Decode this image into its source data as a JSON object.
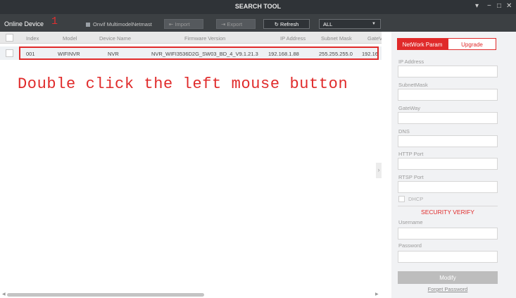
{
  "window": {
    "title": "SEARCH TOOL",
    "controls": [
      "▾",
      "−",
      "□",
      "✕"
    ]
  },
  "toolbar": {
    "online_label": "Online Device",
    "marker": "1",
    "onvif_label": "Onvif MultimodelNetmast",
    "import_label": "Import",
    "export_label": "Export",
    "refresh_label": "Refresh",
    "filter_value": "ALL"
  },
  "table": {
    "columns": [
      "Index",
      "Model",
      "Device Name",
      "Firmware Version",
      "IP Address",
      "Subnet Mask",
      "GateV"
    ],
    "rows": [
      {
        "index": "001",
        "model": "WIFINVR",
        "device_name": "NVR",
        "firmware": "NVR_WIFI3536D2G_SW03_BD_4_V9.1.21.3",
        "ip": "192.168.1.88",
        "mask": "255.255.255.0",
        "gateway": "192.16"
      }
    ]
  },
  "hint_text": "Double click the left mouse button",
  "panel": {
    "tab_network": "NetWork Param",
    "tab_upgrade": "Upgrade",
    "fields": {
      "ip": "IP Address",
      "mask": "SubnetMask",
      "gateway": "GateWay",
      "dns": "DNS",
      "http_port": "HTTP Port",
      "rtsp_port": "RTSP Port"
    },
    "dhcp_label": "DHCP",
    "security_title": "SECURITY VERIFY",
    "username_label": "Username",
    "password_label": "Password",
    "modify_label": "Modify",
    "forgot_label": "Forget Password"
  },
  "colors": {
    "accent": "#e02a2a",
    "titlebar": "#2f3337",
    "toolbar": "#3c4043"
  }
}
